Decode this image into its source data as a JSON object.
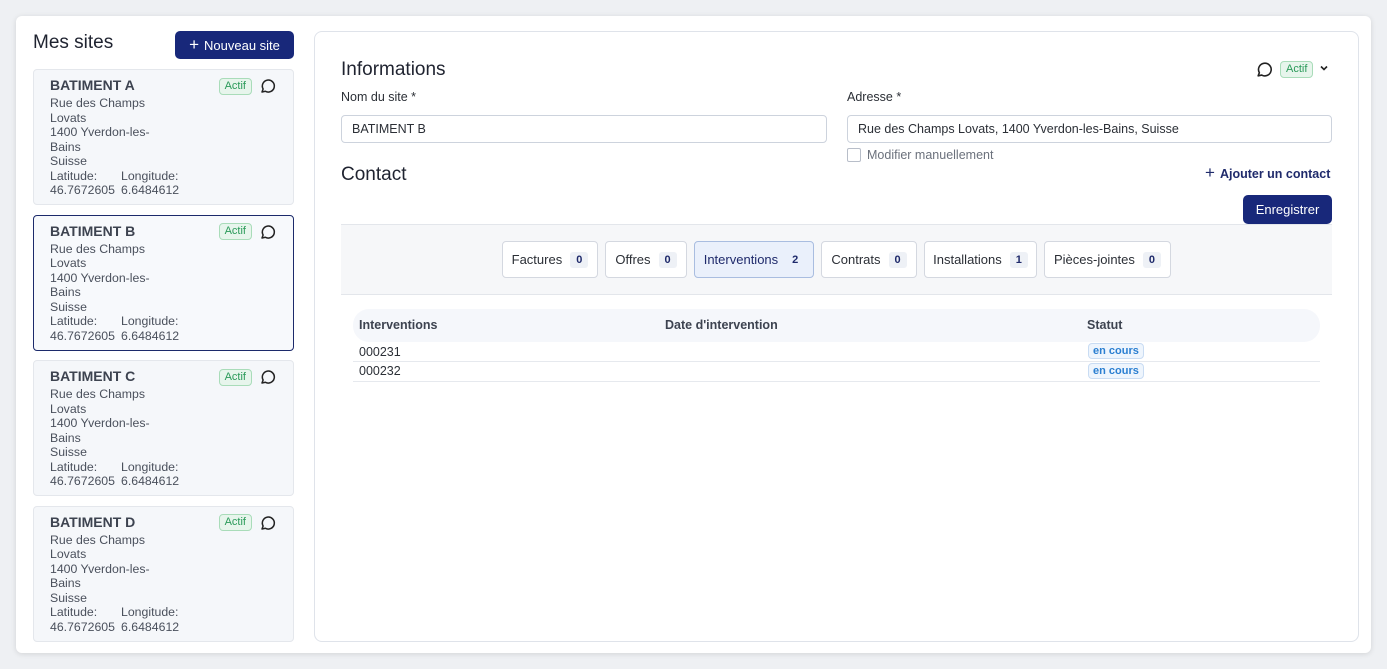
{
  "left": {
    "title": "Mes sites",
    "new_button": "Nouveau site",
    "sites": [
      {
        "name": "BATIMENT A",
        "status": "Actif",
        "street1": "Rue des Champs",
        "street2": "Lovats",
        "city1": "1400 Yverdon-les-",
        "city2": "Bains",
        "country": "Suisse",
        "lat_label": "Latitude:",
        "lon_label": "Longitude:",
        "lat": "46.7672605",
        "lon": "6.6484612"
      },
      {
        "name": "BATIMENT B",
        "status": "Actif",
        "street1": "Rue des Champs",
        "street2": "Lovats",
        "city1": "1400 Yverdon-les-",
        "city2": "Bains",
        "country": "Suisse",
        "lat_label": "Latitude:",
        "lon_label": "Longitude:",
        "lat": "46.7672605",
        "lon": "6.6484612"
      },
      {
        "name": "BATIMENT C",
        "status": "Actif",
        "street1": "Rue des Champs",
        "street2": "Lovats",
        "city1": "1400 Yverdon-les-",
        "city2": "Bains",
        "country": "Suisse",
        "lat_label": "Latitude:",
        "lon_label": "Longitude:",
        "lat": "46.7672605",
        "lon": "6.6484612"
      },
      {
        "name": "BATIMENT D",
        "status": "Actif",
        "street1": "Rue des Champs",
        "street2": "Lovats",
        "city1": "1400 Yverdon-les-",
        "city2": "Bains",
        "country": "Suisse",
        "lat_label": "Latitude:",
        "lon_label": "Longitude:",
        "lat": "46.7672605",
        "lon": "6.6484612"
      }
    ]
  },
  "info": {
    "title": "Informations",
    "status": "Actif",
    "site_name_label": "Nom du site *",
    "site_name_value": "BATIMENT B",
    "address_label": "Adresse *",
    "address_value": "Rue des Champs Lovats, 1400 Yverdon-les-Bains, Suisse",
    "manual_label": "Modifier manuellement"
  },
  "contact": {
    "title": "Contact",
    "add_label": "Ajouter un contact",
    "save_label": "Enregistrer"
  },
  "tabs": [
    {
      "label": "Factures",
      "count": "0"
    },
    {
      "label": "Offres",
      "count": "0"
    },
    {
      "label": "Interventions",
      "count": "2"
    },
    {
      "label": "Contrats",
      "count": "0"
    },
    {
      "label": "Installations",
      "count": "1"
    },
    {
      "label": "Pièces-jointes",
      "count": "0"
    }
  ],
  "table": {
    "headers": [
      "Interventions",
      "Date d'intervention",
      "Statut"
    ],
    "rows": [
      {
        "id": "000231",
        "date": "",
        "status": "en cours"
      },
      {
        "id": "000232",
        "date": "",
        "status": "en cours"
      }
    ]
  },
  "colors": {
    "primary": "#18287a",
    "active_green": "#2a9a59",
    "status_blue": "#2b7fd1"
  }
}
